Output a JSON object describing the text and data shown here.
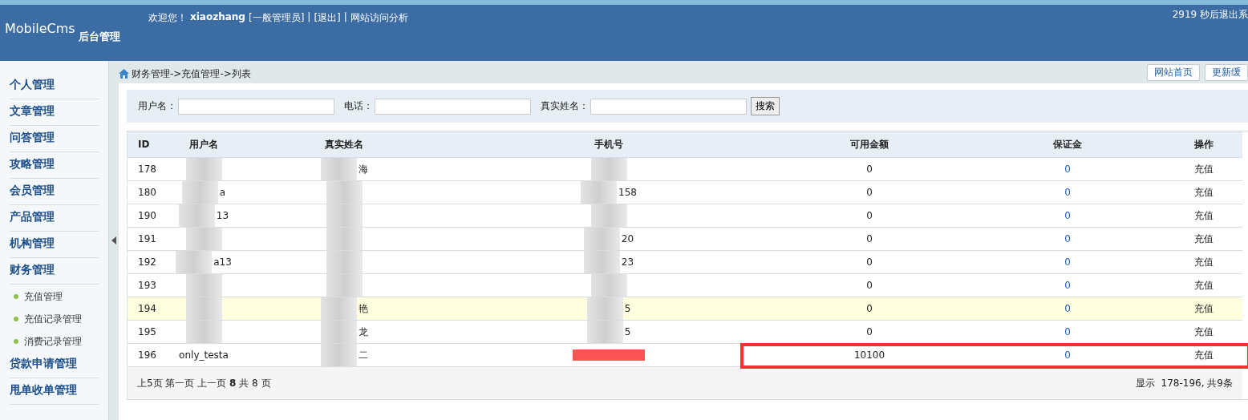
{
  "header": {
    "logo": "MobileCms",
    "subtitle": "后台管理",
    "welcome": "欢迎您！",
    "username": "xiaozhang",
    "role": "[一般管理员]",
    "logout": "[退出]",
    "analytics": "网站访问分析",
    "separators": [
      "|",
      "|"
    ],
    "countdown": "2919 秒后退出系"
  },
  "sidebar": {
    "items": [
      {
        "label": "个人管理"
      },
      {
        "label": "文章管理"
      },
      {
        "label": "问答管理"
      },
      {
        "label": "攻略管理"
      },
      {
        "label": "会员管理"
      },
      {
        "label": "产品管理"
      },
      {
        "label": "机构管理"
      },
      {
        "label": "财务管理",
        "children": [
          {
            "label": "充值管理"
          },
          {
            "label": "充值记录管理"
          },
          {
            "label": "消费记录管理"
          }
        ]
      },
      {
        "label": "贷款申请管理"
      },
      {
        "label": "甩单收单管理"
      }
    ]
  },
  "breadcrumb": "财务管理->充值管理->列表",
  "top_buttons": [
    "网站首页",
    "更新缓"
  ],
  "search": {
    "fields": [
      {
        "label": "用户名："
      },
      {
        "label": "电话："
      },
      {
        "label": "真实姓名："
      }
    ],
    "button": "搜索"
  },
  "table": {
    "columns": [
      "ID",
      "用户名",
      "真实姓名",
      "手机号",
      "可用金额",
      "保证金",
      "操作"
    ],
    "rows": [
      {
        "id": "178",
        "username": {
          "kind": "blurred"
        },
        "realname": {
          "kind": "blurred",
          "text": "海"
        },
        "phone": {
          "kind": "blurred"
        },
        "amount": "0",
        "deposit": "0",
        "action": "充值",
        "selected": false,
        "highlighted": false
      },
      {
        "id": "180",
        "username": {
          "kind": "blurred",
          "text": "a"
        },
        "realname": {
          "kind": "blurred"
        },
        "phone": {
          "kind": "blurred",
          "text": "158"
        },
        "amount": "0",
        "deposit": "0",
        "action": "充值",
        "selected": false,
        "highlighted": false
      },
      {
        "id": "190",
        "username": {
          "kind": "blurred",
          "text": "13"
        },
        "realname": {
          "kind": "blurred"
        },
        "phone": {
          "kind": "blurred"
        },
        "amount": "0",
        "deposit": "0",
        "action": "充值",
        "selected": false,
        "highlighted": false
      },
      {
        "id": "191",
        "username": {
          "kind": "blurred"
        },
        "realname": {
          "kind": "blurred"
        },
        "phone": {
          "kind": "blurred",
          "text": "20"
        },
        "amount": "0",
        "deposit": "0",
        "action": "充值",
        "selected": false,
        "highlighted": false
      },
      {
        "id": "192",
        "username": {
          "kind": "blurred",
          "text": "a13"
        },
        "realname": {
          "kind": "blurred"
        },
        "phone": {
          "kind": "blurred",
          "text": "23"
        },
        "amount": "0",
        "deposit": "0",
        "action": "充值",
        "selected": false,
        "highlighted": false
      },
      {
        "id": "193",
        "username": {
          "kind": "blurred"
        },
        "realname": {
          "kind": "blurred"
        },
        "phone": {
          "kind": "blurred"
        },
        "amount": "0",
        "deposit": "0",
        "action": "充值",
        "selected": false,
        "highlighted": false
      },
      {
        "id": "194",
        "username": {
          "kind": "blurred"
        },
        "realname": {
          "kind": "blurred",
          "text": "艳"
        },
        "phone": {
          "kind": "blurred",
          "text": "5"
        },
        "amount": "0",
        "deposit": "0",
        "action": "充值",
        "selected": true,
        "highlighted": false
      },
      {
        "id": "195",
        "username": {
          "kind": "blurred"
        },
        "realname": {
          "kind": "blurred",
          "text": "龙"
        },
        "phone": {
          "kind": "blurred",
          "text": "5"
        },
        "amount": "0",
        "deposit": "0",
        "action": "充值",
        "selected": false,
        "highlighted": false
      },
      {
        "id": "196",
        "username": {
          "kind": "plain",
          "text": "only_testa"
        },
        "realname": {
          "kind": "blurred",
          "text": "二"
        },
        "phone": {
          "kind": "redbar"
        },
        "amount": "10100",
        "deposit": "0",
        "action": "充值",
        "selected": false,
        "highlighted": true
      }
    ]
  },
  "pagination": {
    "pages": "上5页 第一页 上一页 **8** 共 8 页",
    "summary": "显示  178-196, 共9条"
  }
}
